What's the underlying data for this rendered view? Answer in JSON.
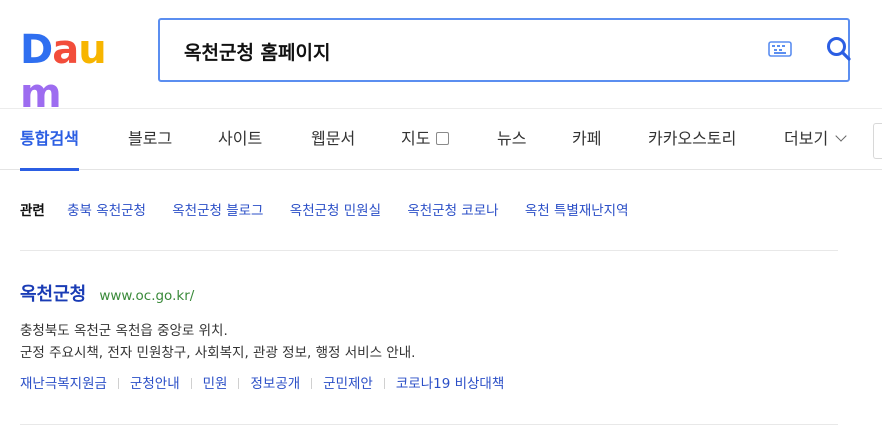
{
  "logo": {
    "letters": [
      "D",
      "a",
      "u",
      "m"
    ],
    "colors": [
      "#2f6ff0",
      "#f24d3b",
      "#f7b500",
      "#9d6cf0"
    ]
  },
  "search": {
    "query": "옥천군청 홈페이지"
  },
  "icons": {
    "keyboard": "keyboard-icon",
    "search": "search-icon",
    "map": "map-icon",
    "more": "chevron-down-icon"
  },
  "tabs": [
    {
      "label": "통합검색",
      "active": true
    },
    {
      "label": "블로그"
    },
    {
      "label": "사이트"
    },
    {
      "label": "웹문서"
    },
    {
      "label": "지도"
    },
    {
      "label": "뉴스"
    },
    {
      "label": "카페"
    },
    {
      "label": "카카오스토리"
    },
    {
      "label": "더보기"
    }
  ],
  "related": {
    "label": "관련",
    "links": [
      "충북 옥천군청",
      "옥천군청 블로그",
      "옥천군청 민원실",
      "옥천군청 코로나",
      "옥천 특별재난지역"
    ]
  },
  "result": {
    "title": "옥천군청",
    "url": "www.oc.go.kr/",
    "desc_line1": "충청북도 옥천군 옥천읍 중앙로 위치.",
    "desc_line2": "군정 주요시책, 전자 민원창구, 사회복지, 관광 정보, 행정 서비스 안내.",
    "sublinks": [
      "재난극복지원금",
      "군청안내",
      "민원",
      "정보공개",
      "군민제안",
      "코로나19 비상대책"
    ]
  },
  "colors": {
    "accent": "#2b5ee3",
    "link": "#2b4fc7",
    "url": "#3a8a3a",
    "search_border": "#5b8ef0"
  }
}
